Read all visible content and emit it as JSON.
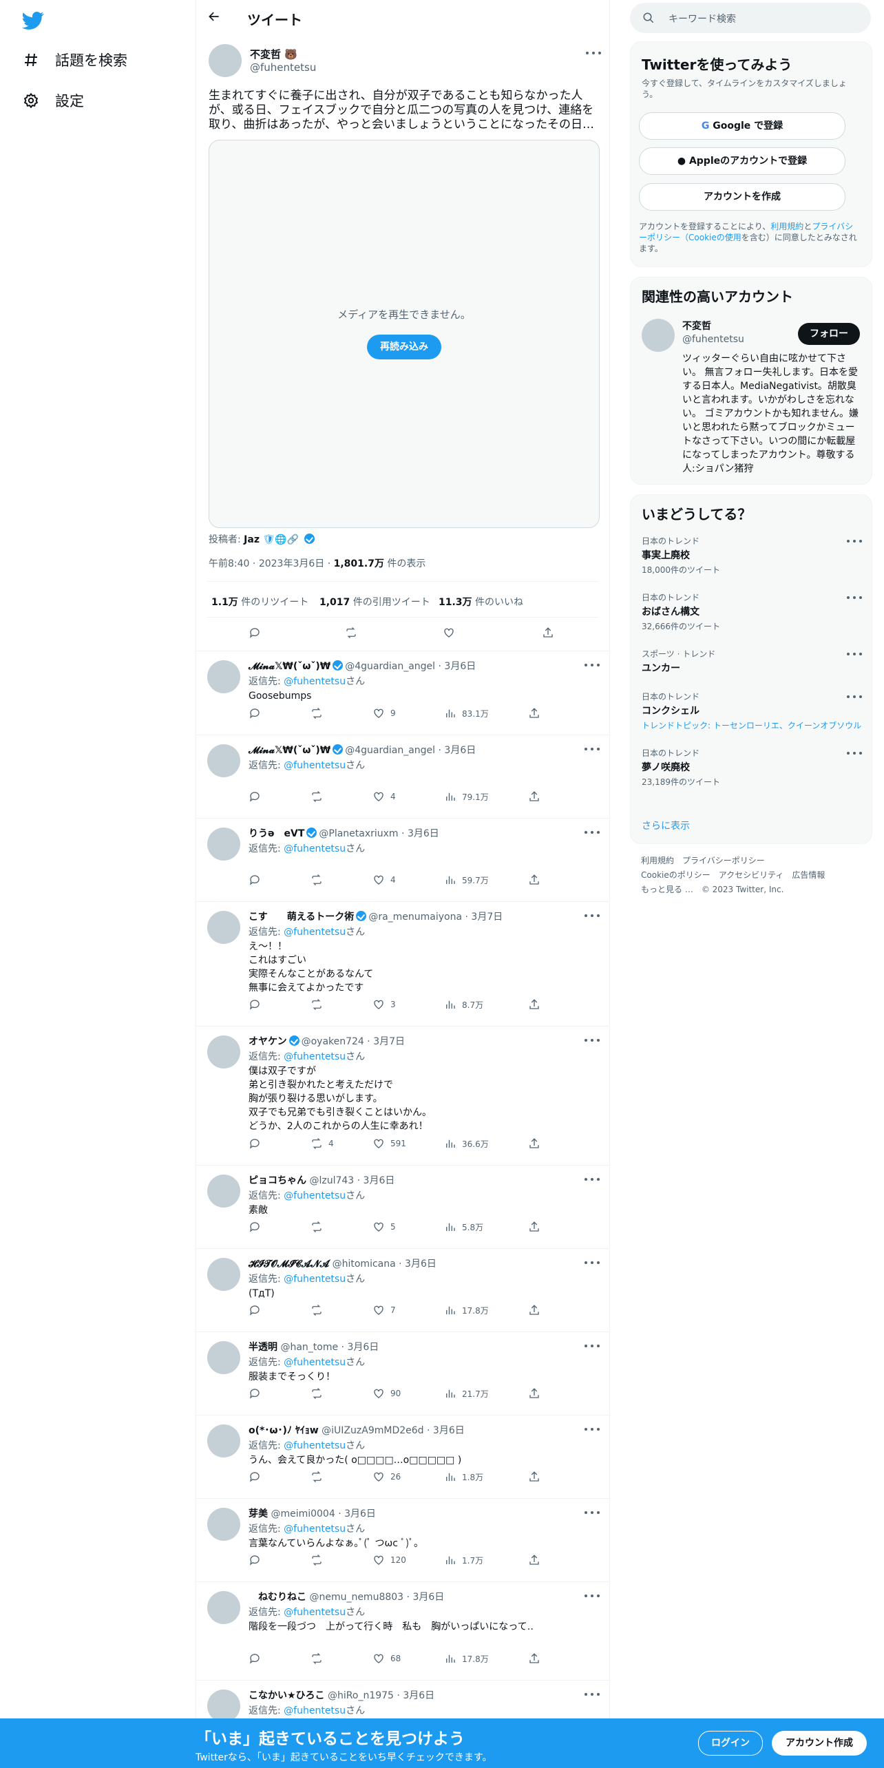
{
  "nav": {
    "explore": "話題を検索",
    "settings": "設定"
  },
  "header": {
    "title": "ツイート"
  },
  "tweet": {
    "name": "不変哲",
    "handle": "@fuhentetsu",
    "text": "生まれてすぐに養子に出され、自分が双子であることも知らなかった人が、或る日、フェイスブックで自分と瓜二つの写真の人を見つけ、連絡を取り、曲折はあったが、やっと会いましょうということになったその日…",
    "media_message": "メディアを再生できません。",
    "reload": "再読み込み",
    "poster_label": "投稿者:",
    "poster_name": "Jaz",
    "time": "午前8:40",
    "date": "2023年3月6日",
    "views_count": "1,801.7万",
    "views_label": "件の表示",
    "retweets_count": "1.1万",
    "retweets_label": "件のリツイート",
    "quotes_count": "1,017",
    "quotes_label": "件の引用ツイート",
    "likes_count": "11.3万",
    "likes_label": "件のいいね"
  },
  "reply_to_label": "返信先:",
  "reply_to_handle": "@fuhentetsu",
  "reply_to_suffix": "さん",
  "replies": [
    {
      "name": "𝓜𝓲𝓷𝓪𝕏₩(ˇωˇ)₩",
      "verified": true,
      "handle": "@4guardian_angel",
      "date": "3月6日",
      "text": "Goosebumps",
      "retweets": "",
      "likes": "9",
      "views": "83.1万"
    },
    {
      "name": "𝓜𝓲𝓷𝓪𝕏₩(ˇωˇ)₩",
      "verified": true,
      "handle": "@4guardian_angel",
      "date": "3月6日",
      "text": "",
      "retweets": "",
      "likes": "4",
      "views": "79.1万"
    },
    {
      "name": "りうə　eVT",
      "verified": true,
      "handle": "@Planetaxriuxm",
      "date": "3月6日",
      "text": "",
      "retweets": "",
      "likes": "4",
      "views": "59.7万"
    },
    {
      "name": "こす　　萌えるトーク術",
      "verified": true,
      "handle": "@ra_menumaiyona",
      "date": "3月7日",
      "text": "え〜！！\nこれはすごい\n実際そんなことがあるなんて\n無事に会えてよかったです",
      "retweets": "",
      "likes": "3",
      "views": "8.7万"
    },
    {
      "name": "オヤケン",
      "verified": true,
      "handle": "@oyaken724",
      "date": "3月7日",
      "text": "僕は双子ですが\n弟と引き裂かれたと考えただけで\n胸が張り裂ける思いがします。\n双子でも兄弟でも引き裂くことはいかん。\nどうか、2人のこれからの人生に幸あれ！",
      "retweets": "4",
      "likes": "591",
      "views": "36.6万"
    },
    {
      "name": "ピョコちゃん",
      "verified": false,
      "handle": "@lzul743",
      "date": "3月6日",
      "text": "素敵",
      "retweets": "",
      "likes": "5",
      "views": "5.8万"
    },
    {
      "name": "𝓗𝓘𝓣𝓞𝓜𝓘𝓒𝓐𝓝𝓐",
      "verified": false,
      "handle": "@hitomicana",
      "date": "3月6日",
      "text": "(TдT)",
      "retweets": "",
      "likes": "7",
      "views": "17.8万"
    },
    {
      "name": "半透明",
      "verified": false,
      "handle": "@han_tome",
      "date": "3月6日",
      "text": "服装までそっくり！",
      "retweets": "",
      "likes": "90",
      "views": "21.7万"
    },
    {
      "name": "o(*･ω･)ﾉ ﾔｲｮw",
      "verified": false,
      "handle": "@iUIZuzA9mMD2e6d",
      "date": "3月6日",
      "text": "うん、会えて良かった( o□□□□…o□□□□□ )",
      "retweets": "",
      "likes": "26",
      "views": "1.8万"
    },
    {
      "name": "芽美",
      "verified": false,
      "handle": "@meimi0004",
      "date": "3月6日",
      "text": "言葉なんていらんよなぁ｡ﾟ(ﾟ つωc ﾟ)ﾟ｡",
      "retweets": "",
      "likes": "120",
      "views": "1.7万"
    },
    {
      "name": "　ねむりねこ",
      "verified": false,
      "handle": "@nemu_nemu8803",
      "date": "3月6日",
      "text": "階段を一段づつ　上がって行く時　私も　胸がいっぱいになって‥",
      "retweets": "",
      "likes": "68",
      "views": "17.8万"
    },
    {
      "name": "こなかい★ひろこ",
      "verified": false,
      "handle": "@hiRo_n1975",
      "date": "3月6日",
      "text": "",
      "retweets": "",
      "likes": "",
      "views": ""
    }
  ],
  "right": {
    "search_placeholder": "キーワード検索",
    "signup_card": {
      "title": "Twitterを使ってみよう",
      "subtitle": "今すぐ登録して、タイムラインをカスタマイズしましょう。",
      "google": "Google で登録",
      "apple": "Appleのアカウントで登録",
      "create": "アカウントを作成",
      "terms_pre": "アカウントを登録することにより、",
      "terms_link": "利用規約",
      "terms_mid": "と",
      "privacy_link": "プライバシーポリシー（Cookieの使用",
      "terms_post": "を含む）に同意したとみなされます。"
    },
    "related": {
      "title": "関連性の高いアカウント",
      "name": "不変哲",
      "handle": "@fuhentetsu",
      "follow": "フォロー",
      "bio": "ツィッターぐらい自由に呟かせて下さい。 無言フォロー失礼します。日本を愛する日本人。MediaNegativist。胡散臭いと言われます。いかがわしさを忘れない。 ゴミアカウントかも知れません。嫌いと思われたら黙ってブロックかミュートなさって下さい。いつの間にか転載屋になってしまったアカウント。尊敬する人:ショパン猪狩"
    },
    "trends": {
      "title": "いまどうしてる？",
      "items": [
        {
          "category": "日本のトレンド",
          "name": "事実上廃校",
          "count": "18,000件のツイート",
          "sub": ""
        },
        {
          "category": "日本のトレンド",
          "name": "おばさん構文",
          "count": "32,666件のツイート",
          "sub": ""
        },
        {
          "category": "スポーツ · トレンド",
          "name": "ユンカー",
          "count": "",
          "sub": ""
        },
        {
          "category": "日本のトレンド",
          "name": "コンクシェル",
          "count": "",
          "sub": "トレンドトピック: トーセンローリエ、クイーンオブソウル"
        },
        {
          "category": "日本のトレンド",
          "name": "夢ノ咲廃校",
          "count": "23,189件のツイート",
          "sub": ""
        }
      ],
      "show_more": "さらに表示"
    },
    "footer": {
      "line1": "利用規約　プライバシーポリシー",
      "line2": "Cookieのポリシー　アクセシビリティ　広告情報",
      "line3": "もっと見る …　© 2023 Twitter, Inc."
    }
  },
  "bottombar": {
    "title": "「いま」起きていることを見つけよう",
    "subtitle": "Twitterなら、「いま」起きていることをいち早くチェックできます。",
    "login": "ログイン",
    "signup": "アカウント作成"
  },
  "colors": {
    "accent": "#1d9bf0",
    "text": "#0f1419",
    "muted": "#536471"
  }
}
